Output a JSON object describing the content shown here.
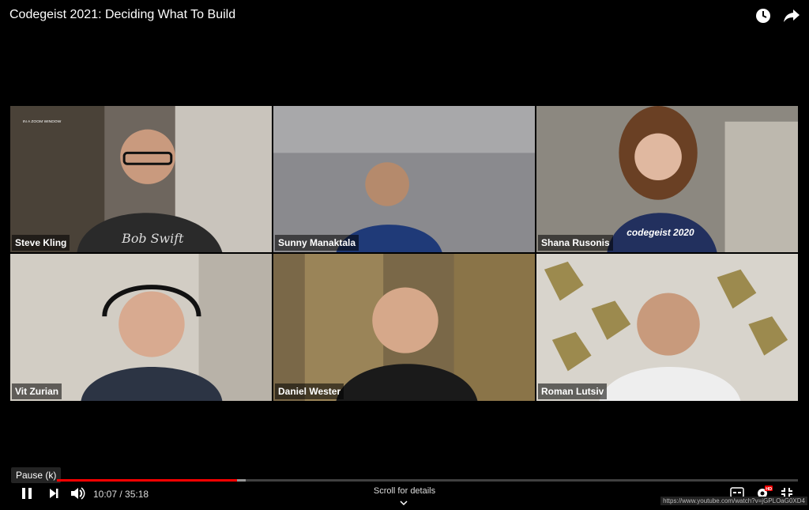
{
  "video": {
    "title": "Codegeist 2021: Deciding What To Build"
  },
  "top_actions": [
    {
      "name": "watch-later-icon"
    },
    {
      "name": "share-icon"
    }
  ],
  "participants": [
    {
      "name": "Steve Kling",
      "tile_color": "#5a5550"
    },
    {
      "name": "Sunny Manaktala",
      "tile_color": "#7d7d80"
    },
    {
      "name": "Shana Rusonis",
      "tile_color": "#6a6660"
    },
    {
      "name": "Vit Zurian",
      "tile_color": "#b8b2a8"
    },
    {
      "name": "Daniel Wester",
      "tile_color": "#7a6040"
    },
    {
      "name": "Roman Lutsiv",
      "tile_color": "#c8c4bc"
    }
  ],
  "tile_text": {
    "zoom_window_label": "IN A ZOOM WINDOW",
    "shirt_steve": "Bob Swift",
    "shirt_shana": "codegeist 2020"
  },
  "player": {
    "tooltip": "Pause (k)",
    "current_time": "10:07",
    "duration": "35:18",
    "time_display": "10:07 / 35:18",
    "played_fraction": 0.243,
    "loaded_fraction": 0.255,
    "scroll_hint": "Scroll for details",
    "url": "https://www.youtube.com/watch?v=jGPLOaG0XD4",
    "hd_badge": "HD",
    "accent_color": "#ff0000"
  }
}
